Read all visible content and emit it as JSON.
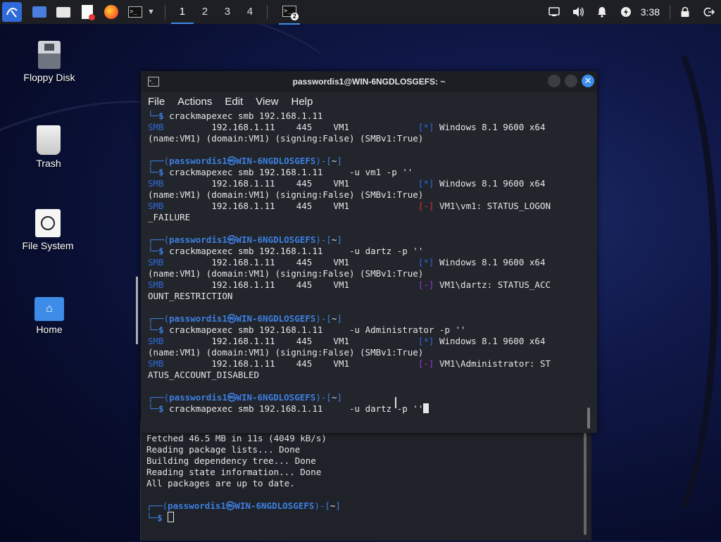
{
  "panel": {
    "workspaces": [
      "1",
      "2",
      "3",
      "4"
    ],
    "task_badge": "2",
    "clock": "3:38"
  },
  "desktop": {
    "icons": [
      {
        "label": "Floppy Disk"
      },
      {
        "label": "Trash"
      },
      {
        "label": "File System"
      },
      {
        "label": "Home"
      }
    ]
  },
  "terminal": {
    "title": "passwordis1@WIN-6NGDLOSGEFS: ~",
    "menu": [
      "File",
      "Actions",
      "Edit",
      "View",
      "Help"
    ],
    "user": "passwordis1",
    "host": "WIN-6NGDLOSGEFS",
    "dir": "~",
    "smb": "SMB",
    "ip": "192.168.1.11",
    "port": "445",
    "vm": "VM1",
    "win_info": "Windows 8.1 9600 x64",
    "name_line": "(name:VM1) (domain:VM1) (signing:False) (SMBv1:True)",
    "commands": [
      "crackmapexec smb 192.168.1.11",
      "crackmapexec smb 192.168.1.11     -u vm1 -p ''",
      "crackmapexec smb 192.168.1.11     -u dartz -p ''",
      "crackmapexec smb 192.168.1.11     -u Administrator -p ''",
      "crackmapexec smb 192.168.1.11     -u dartz -p ''"
    ],
    "results": [
      {
        "msg1": "VM1\\vm1: STATUS_LOGON",
        "msg2": "_FAILURE"
      },
      {
        "msg1": "VM1\\dartz: STATUS_ACC",
        "msg2": "OUNT_RESTRICTION"
      },
      {
        "msg1": "VM1\\Administrator: ST",
        "msg2": "ATUS_ACCOUNT_DISABLED"
      }
    ]
  },
  "background_terminal": {
    "lines": [
      "Fetched 46.5 MB in 11s (4049 kB/s)",
      "Reading package lists... Done",
      "Building dependency tree... Done",
      "Reading state information... Done",
      "All packages are up to date."
    ]
  }
}
